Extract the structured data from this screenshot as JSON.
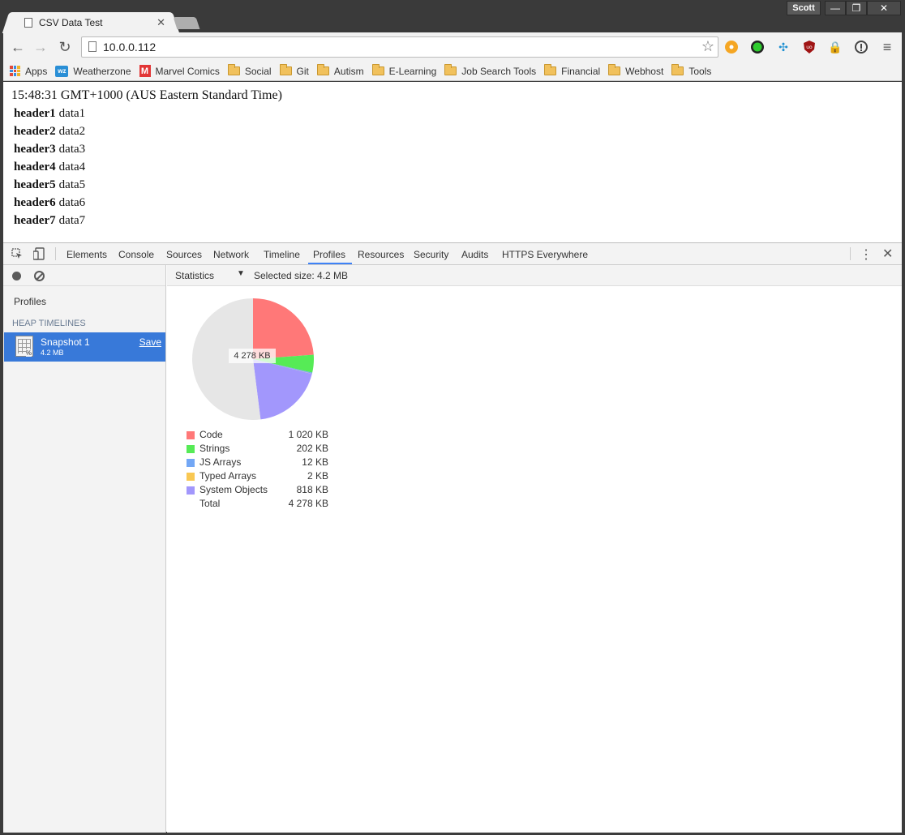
{
  "window": {
    "tab_title": "CSV Data Test",
    "profile_name": "Scott",
    "min_glyph": "—",
    "max_glyph": "❐",
    "close_glyph": "✕"
  },
  "toolbar": {
    "url": "10.0.0.112"
  },
  "bookmarks": [
    {
      "label": "Apps",
      "icon": "apps-grid-icon"
    },
    {
      "label": "Weatherzone",
      "icon": "weatherzone-icon"
    },
    {
      "label": "Marvel Comics",
      "icon": "marvel-icon"
    },
    {
      "label": "Social",
      "icon": "folder-icon"
    },
    {
      "label": "Git",
      "icon": "folder-icon"
    },
    {
      "label": "Autism",
      "icon": "folder-icon"
    },
    {
      "label": "E-Learning",
      "icon": "folder-icon"
    },
    {
      "label": "Job Search Tools",
      "icon": "folder-icon"
    },
    {
      "label": "Financial",
      "icon": "folder-icon"
    },
    {
      "label": "Webhost",
      "icon": "folder-icon"
    },
    {
      "label": "Tools",
      "icon": "folder-icon"
    }
  ],
  "page": {
    "timestamp": "15:48:31 GMT+1000 (AUS Eastern Standard Time)",
    "rows": [
      {
        "header": "header1",
        "data": "data1"
      },
      {
        "header": "header2",
        "data": "data2"
      },
      {
        "header": "header3",
        "data": "data3"
      },
      {
        "header": "header4",
        "data": "data4"
      },
      {
        "header": "header5",
        "data": "data5"
      },
      {
        "header": "header6",
        "data": "data6"
      },
      {
        "header": "header7",
        "data": "data7"
      }
    ]
  },
  "devtools": {
    "tabs": [
      "Elements",
      "Console",
      "Sources",
      "Network",
      "Timeline",
      "Profiles",
      "Resources",
      "Security",
      "Audits",
      "HTTPS Everywhere"
    ],
    "active_tab": "Profiles",
    "sidebar": {
      "profiles_label": "Profiles",
      "section_label": "HEAP TIMELINES",
      "snapshot_name": "Snapshot 1",
      "snapshot_size": "4.2 MB",
      "save_label": "Save"
    },
    "view_select": "Statistics",
    "selected_size": "Selected size: 4.2 MB"
  },
  "chart_data": {
    "type": "pie",
    "center_label": "4 278 KB",
    "total_label": "Total",
    "total_value": "4 278 KB",
    "slices": [
      {
        "name": "Code",
        "value": 1020,
        "label": "1 020 KB",
        "color": "#ff7878"
      },
      {
        "name": "Strings",
        "value": 202,
        "label": "202 KB",
        "color": "#56eb56"
      },
      {
        "name": "JS Arrays",
        "value": 12,
        "label": "12 KB",
        "color": "#73a7f5"
      },
      {
        "name": "Typed Arrays",
        "value": 2,
        "label": "2 KB",
        "color": "#f9c853"
      },
      {
        "name": "System Objects",
        "value": 818,
        "label": "818 KB",
        "color": "#a297fc"
      }
    ],
    "total": 4278,
    "remainder_color": "#e6e6e6"
  }
}
